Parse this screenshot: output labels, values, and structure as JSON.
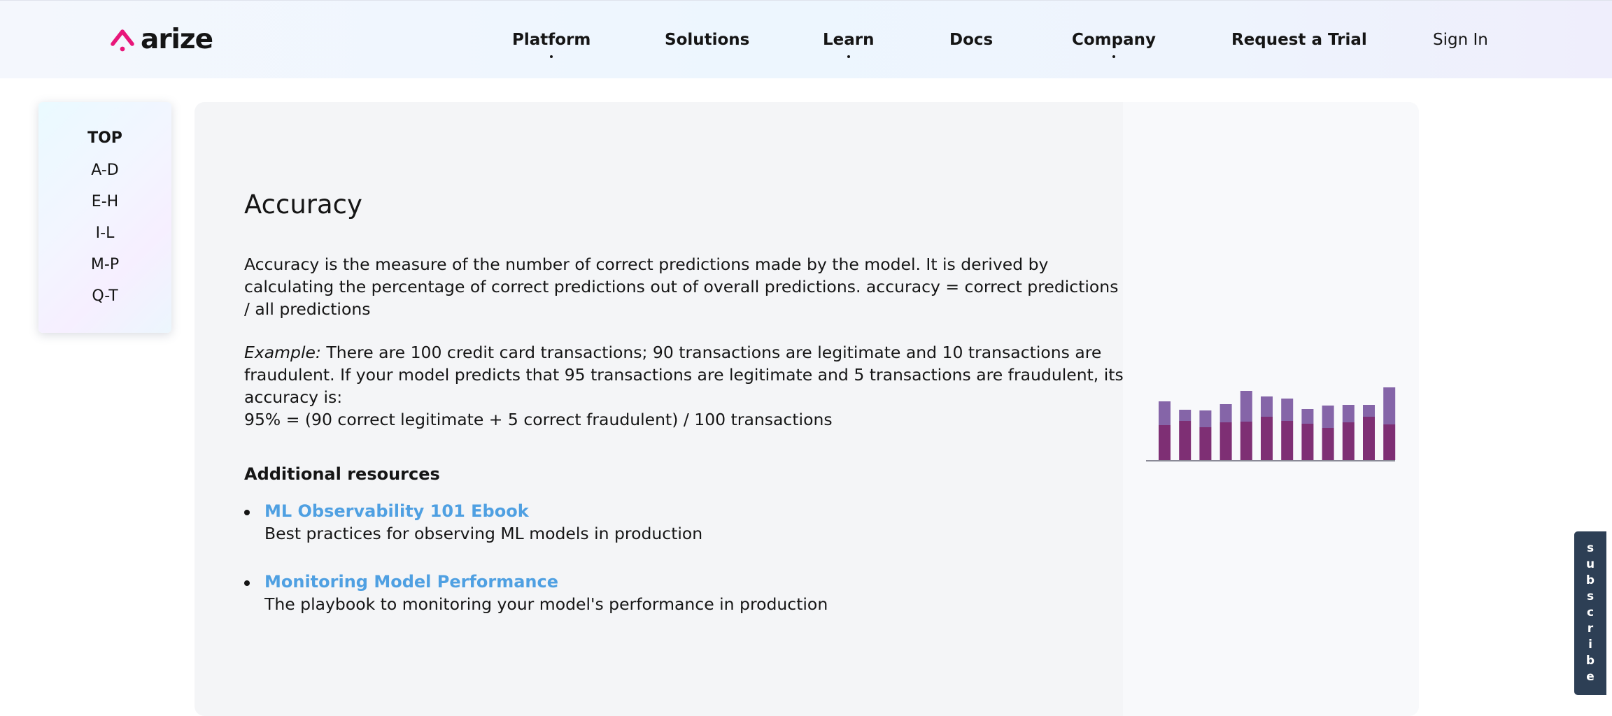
{
  "brand": {
    "name": "arize",
    "accent": "#e8177a"
  },
  "nav": {
    "items": [
      {
        "label": "Platform",
        "dropdown": true
      },
      {
        "label": "Solutions",
        "dropdown": false
      },
      {
        "label": "Learn",
        "dropdown": true
      },
      {
        "label": "Docs",
        "dropdown": false
      },
      {
        "label": "Company",
        "dropdown": true
      },
      {
        "label": "Request a Trial",
        "dropdown": false
      }
    ],
    "sign_in": "Sign In"
  },
  "sidebar": {
    "items": [
      "TOP",
      "A-D",
      "E-H",
      "I-L",
      "M-P",
      "Q-T"
    ]
  },
  "article": {
    "title": "Accuracy",
    "definition": "Accuracy is the measure of the number of correct predictions made by the model. It is derived by calculating the percentage of correct predictions out of overall predictions. accuracy = correct predictions / all predictions",
    "example_label": "Example:",
    "example_text": " There are 100 credit card transactions; 90 transactions are legitimate and 10 transactions are fraudulent. If your model predicts that 95 transactions are legitimate and 5 transactions are fraudulent, its accuracy is:",
    "example_formula": "95% = (90 correct legitimate + 5 correct fraudulent) / 100 transactions"
  },
  "resources": {
    "heading": "Additional resources",
    "items": [
      {
        "title": "ML Observability 101 Ebook",
        "description": "Best practices for observing ML models in production"
      },
      {
        "title": "Monitoring Model Performance",
        "description": "The playbook to monitoring your model's performance in production"
      }
    ],
    "link_color": "#4fa0e2"
  },
  "chart_data": {
    "type": "bar",
    "stacked": true,
    "categories": [],
    "series": [
      {
        "values": [
          50,
          56,
          47,
          54,
          55,
          62,
          56,
          52,
          46,
          54,
          62,
          51
        ],
        "color": "#7e2f74"
      },
      {
        "values": [
          34,
          16,
          24,
          26,
          44,
          29,
          32,
          21,
          32,
          25,
          17,
          53
        ],
        "color": "#8565a8"
      }
    ],
    "grid": false,
    "axes": false
  },
  "subscribe": {
    "label": "subscribe",
    "color": "#2d3f55"
  }
}
